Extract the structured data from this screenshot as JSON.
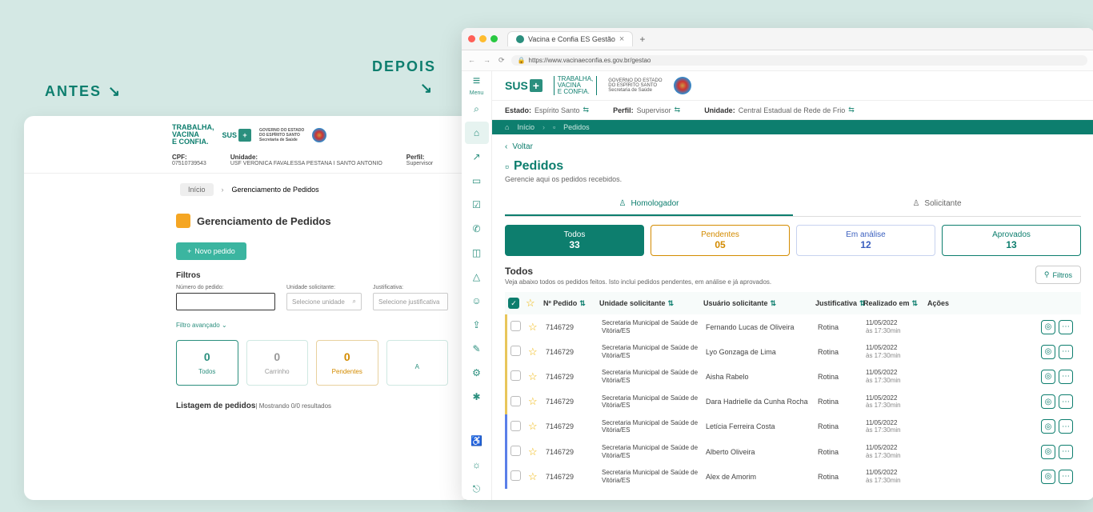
{
  "labels": {
    "antes": "ANTES",
    "depois": "DEPOIS"
  },
  "antes": {
    "logos": {
      "vacina": "TRABALHA,\nVACINA\nE CONFIA.",
      "sus": "SUS",
      "gov": "GOVERNO DO ESTADO\nDO ESPÍRITO SANTO\nSecretaria de Saúde"
    },
    "info": {
      "cpf_label": "CPF:",
      "cpf": "07510739543",
      "unidade_label": "Unidade:",
      "unidade": "USF VERONICA FAVALESSA PESTANA I SANTO ANTONIO",
      "perfil_label": "Perfil:",
      "perfil": "Supervisor"
    },
    "breadcrumb": {
      "home": "Início",
      "current": "Gerenciamento de Pedidos"
    },
    "title": "Gerenciamento de Pedidos",
    "new_btn": "Novo pedido",
    "filtros_h": "Filtros",
    "filters": {
      "num_label": "Número do pedido:",
      "unid_label": "Unidade solicitante:",
      "unid_placeholder": "Selecione unidade",
      "just_label": "Justificativa:",
      "just_placeholder": "Selecione justificativa"
    },
    "advanced": "Filtro avançado",
    "stats": {
      "todos_n": "0",
      "todos_l": "Todos",
      "carr_n": "0",
      "carr_l": "Carrinho",
      "pend_n": "0",
      "pend_l": "Pendentes",
      "last_l": "A"
    },
    "list_h": "Listagem de pedidos",
    "list_sub": "| Mostrando 0/0 resultados"
  },
  "depois": {
    "tab_title": "Vacina e Confia ES Gestão",
    "url": "https://www.vacinaeconfia.es.gov.br/gestao",
    "menu_label": "Menu",
    "logos": {
      "sus": "SUS",
      "vacina": "TRABALHA,\nVACINA\nE CONFIA.",
      "gov": "GOVERNO DO ESTADO\nDO ESPÍRITO SANTO\nSecretaria de Saúde"
    },
    "context": {
      "estado_l": "Estado:",
      "estado_v": "Espírito Santo",
      "perfil_l": "Perfil:",
      "perfil_v": "Supervisor",
      "unidade_l": "Unidade:",
      "unidade_v": "Central Estadual de Rede de Frio"
    },
    "breadcrumb": {
      "home": "Início",
      "current": "Pedidos"
    },
    "voltar": "Voltar",
    "page_title": "Pedidos",
    "page_sub": "Gerencie aqui os pedidos recebidos.",
    "role_tabs": {
      "homologador": "Homologador",
      "solicitante": "Solicitante"
    },
    "status": {
      "todos_l": "Todos",
      "todos_n": "33",
      "pend_l": "Pendentes",
      "pend_n": "05",
      "anal_l": "Em análise",
      "anal_n": "12",
      "aprov_l": "Aprovados",
      "aprov_n": "13"
    },
    "list_title": "Todos",
    "list_desc": "Veja abaixo todos os pedidos feitos. Isto inclui pedidos pendentes, em análise e já aprovados.",
    "filtros_btn": "Filtros",
    "columns": {
      "num": "Nº Pedido",
      "unid": "Unidade solicitante",
      "usr": "Usuário solicitante",
      "just": "Justificativa",
      "date": "Realizado em",
      "act": "Ações"
    },
    "rows": [
      {
        "status": "pend",
        "num": "7146729",
        "unid": "Secretaria Municipal de Saúde de Vitória/ES",
        "usr": "Fernando Lucas de Oliveira",
        "just": "Rotina",
        "date": "11/05/2022",
        "time": "às 17:30min"
      },
      {
        "status": "pend",
        "num": "7146729",
        "unid": "Secretaria Municipal de Saúde de Vitória/ES",
        "usr": "Lyo Gonzaga de Lima",
        "just": "Rotina",
        "date": "11/05/2022",
        "time": "às 17:30min"
      },
      {
        "status": "pend",
        "num": "7146729",
        "unid": "Secretaria Municipal de Saúde de Vitória/ES",
        "usr": "Aisha Rabelo",
        "just": "Rotina",
        "date": "11/05/2022",
        "time": "às 17:30min"
      },
      {
        "status": "pend",
        "num": "7146729",
        "unid": "Secretaria Municipal de Saúde de Vitória/ES",
        "usr": "Dara Hadrielle da Cunha Rocha",
        "just": "Rotina",
        "date": "11/05/2022",
        "time": "às 17:30min"
      },
      {
        "status": "anal",
        "num": "7146729",
        "unid": "Secretaria Municipal de Saúde de Vitória/ES",
        "usr": "Letícia Ferreira Costa",
        "just": "Rotina",
        "date": "11/05/2022",
        "time": "às 17:30min"
      },
      {
        "status": "anal",
        "num": "7146729",
        "unid": "Secretaria Municipal de Saúde de Vitória/ES",
        "usr": "Alberto Oliveira",
        "just": "Rotina",
        "date": "11/05/2022",
        "time": "às 17:30min"
      },
      {
        "status": "anal",
        "num": "7146729",
        "unid": "Secretaria Municipal de Saúde de Vitória/ES",
        "usr": "Alex de Amorim",
        "just": "Rotina",
        "date": "11/05/2022",
        "time": "às 17:30min"
      }
    ]
  }
}
